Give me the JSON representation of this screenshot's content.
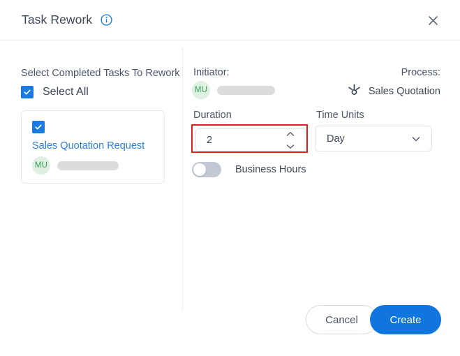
{
  "header": {
    "title": "Task Rework",
    "info_icon": "info-circle-icon",
    "close_icon": "close-icon"
  },
  "left_panel": {
    "heading": "Select Completed Tasks To Rework",
    "select_all_label": "Select All",
    "select_all_checked": true,
    "task_card": {
      "checked": true,
      "task_name": "Sales Quotation Request",
      "assignee_initials": "MU",
      "assignee_name_redacted": true
    }
  },
  "right_panel": {
    "initiator_label": "Initiator:",
    "initiator_initials": "MU",
    "initiator_name_redacted": true,
    "process_label": "Process:",
    "process_icon": "process-node-icon",
    "process_name": "Sales Quotation",
    "duration_label": "Duration",
    "duration_value": "2",
    "duration_stepper_up_icon": "chevron-up-icon",
    "duration_stepper_down_icon": "chevron-down-icon",
    "time_units_label": "Time Units",
    "time_units_value": "Day",
    "time_units_chevron_icon": "chevron-down-icon",
    "business_hours_label": "Business Hours",
    "business_hours_enabled": false
  },
  "footer": {
    "cancel_label": "Cancel",
    "create_label": "Create"
  },
  "colors": {
    "accent_blue": "#1076dd",
    "link_blue": "#2b7fe0",
    "checkbox_blue": "#1a7ae0",
    "highlight_red": "#e02020",
    "avatar_green_bg": "#dff0e2",
    "avatar_green_text": "#35a05a",
    "text_dark": "#3c4858",
    "text_muted": "#4a5568"
  }
}
